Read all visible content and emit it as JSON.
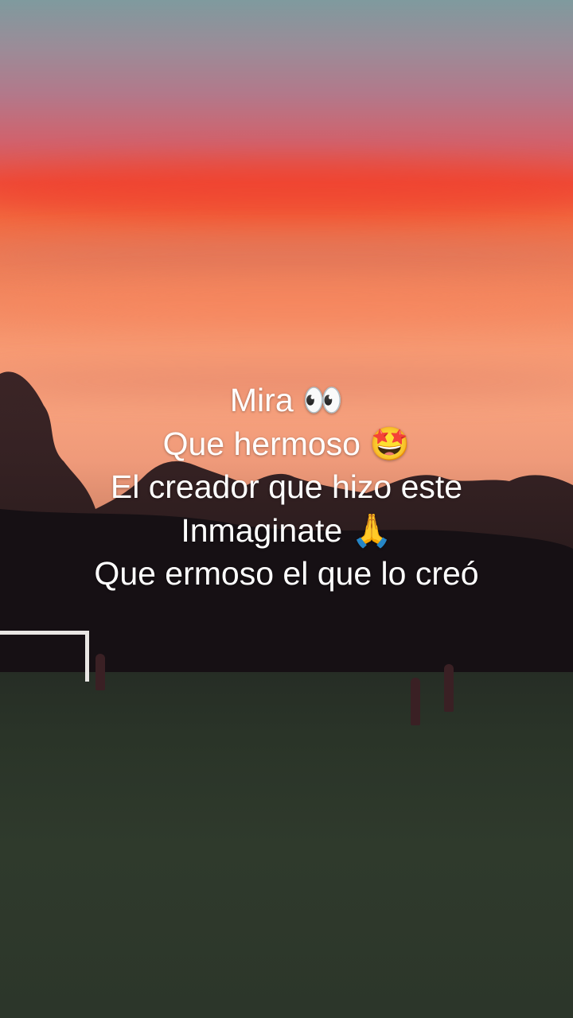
{
  "caption": {
    "lines": [
      "Mira 👀",
      "Que hermoso 🤩",
      "El creador que hizo este",
      "Inmaginate 🙏",
      "Que ermoso el que lo creó"
    ]
  },
  "scene": {
    "description_tags": [
      "sunset-sky",
      "tree-silhouettes",
      "grass-field",
      "soccer-goal",
      "players"
    ],
    "colors": {
      "sky_red": "#ee4f3c",
      "sky_orange": "#f79a73",
      "trees": "#1c1418",
      "grass": "#2a3428"
    }
  }
}
